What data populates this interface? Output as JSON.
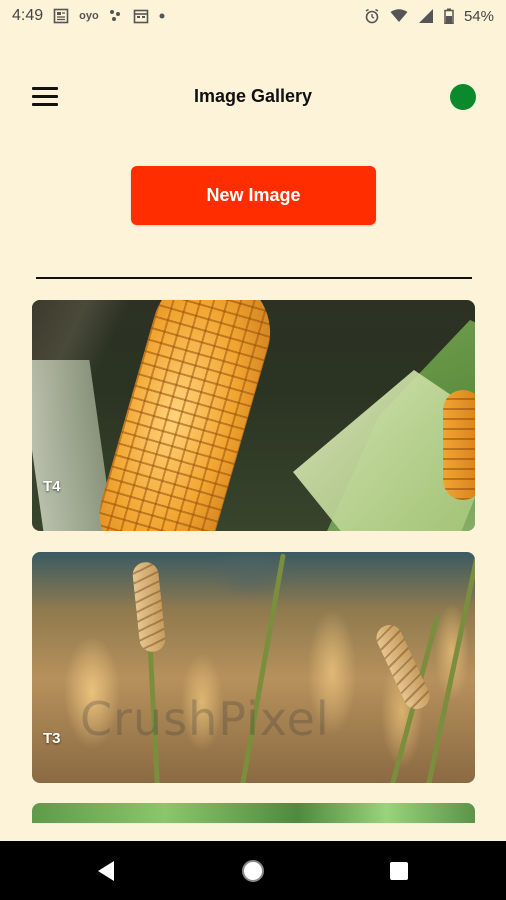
{
  "status_bar": {
    "time": "4:49",
    "left_icons": [
      "news-icon",
      "oyo-icon",
      "dots-icon",
      "calendar-icon",
      "dot-icon"
    ],
    "oyo_text": "oyo",
    "battery_percent": "54%",
    "right_icons": [
      "alarm-icon",
      "wifi-icon",
      "signal-icon",
      "battery-icon"
    ]
  },
  "app_bar": {
    "title": "Image Gallery",
    "menu_icon": "hamburger-menu-icon",
    "status_dot_color": "#0a8a2c"
  },
  "new_image_button": {
    "label": "New Image",
    "color": "#ff2d00"
  },
  "gallery": {
    "items": [
      {
        "label": "T4",
        "image": "corn-cob-photo"
      },
      {
        "label": "T3",
        "image": "wheat-field-photo",
        "watermark": "CrushPixel"
      },
      {
        "label": "",
        "image": "green-leaves-photo"
      }
    ]
  },
  "nav_bar": {
    "buttons": [
      "back-icon",
      "home-icon",
      "recents-icon"
    ]
  },
  "colors": {
    "background": "#fdf3d9",
    "accent": "#ff2d00",
    "online": "#0a8a2c"
  }
}
